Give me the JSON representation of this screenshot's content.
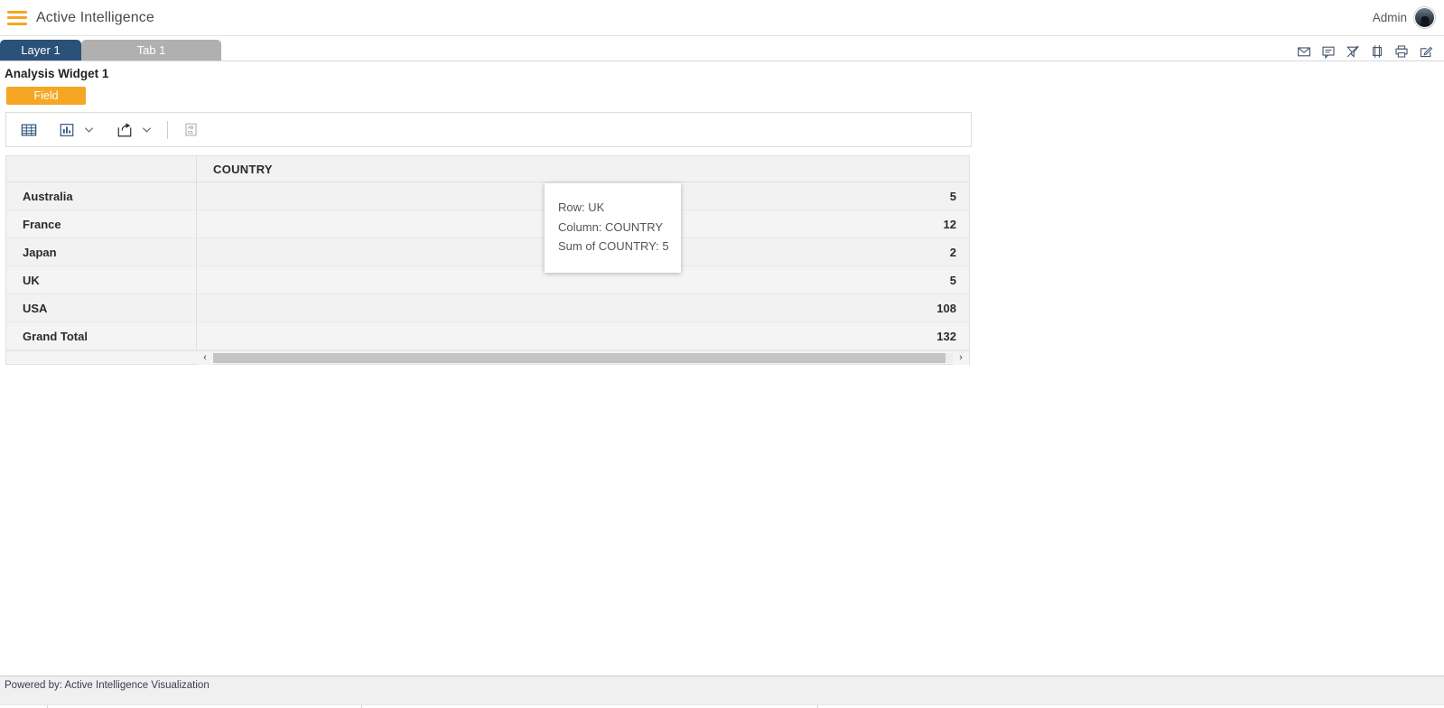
{
  "appbar": {
    "menu_icon": "hamburger-menu-icon",
    "title": "Active Intelligence",
    "user_name": "Admin",
    "avatar_icon": "user-avatar"
  },
  "tabstrip": {
    "tabs": [
      {
        "label": "Layer 1",
        "active": true
      },
      {
        "label": "Tab 1",
        "active": false
      }
    ],
    "actions": [
      {
        "name": "mail-icon",
        "title": "Mail"
      },
      {
        "name": "comment-icon",
        "title": "Comment"
      },
      {
        "name": "clear-filter-icon",
        "title": "Clear Filter"
      },
      {
        "name": "crop-icon",
        "title": "Crop"
      },
      {
        "name": "print-icon",
        "title": "Print"
      },
      {
        "name": "edit-icon",
        "title": "Edit"
      }
    ]
  },
  "widget": {
    "title": "Analysis Widget 1",
    "field_chip": "Field",
    "toolbar": [
      {
        "name": "table-view-icon",
        "title": "Table"
      },
      {
        "name": "chart-view-icon",
        "title": "Chart"
      },
      {
        "name": "chart-dropdown-caret",
        "title": "Chart options"
      },
      {
        "name": "export-share-icon",
        "title": "Export"
      },
      {
        "name": "export-dropdown-caret",
        "title": "Export options"
      },
      {
        "name": "sort-abc-icon",
        "title": "Sort"
      }
    ]
  },
  "pivot": {
    "row_header_label": "",
    "column_header": "COUNTRY",
    "rows": [
      {
        "label": "Australia",
        "value": "5"
      },
      {
        "label": "France",
        "value": "12"
      },
      {
        "label": "Japan",
        "value": "2"
      },
      {
        "label": "UK",
        "value": "5"
      },
      {
        "label": "USA",
        "value": "108"
      },
      {
        "label": "Grand Total",
        "value": "132"
      }
    ],
    "scroll_left_arrow": "‹",
    "scroll_right_arrow": "›"
  },
  "tooltip": {
    "row": "Row:  UK",
    "column": "Column: COUNTRY",
    "sum": "Sum of COUNTRY: 5"
  },
  "footer": {
    "text": "Powered by: Active Intelligence Visualization"
  },
  "chart_data": {
    "type": "table",
    "title": "Analysis Widget 1",
    "categories": [
      "Australia",
      "France",
      "Japan",
      "UK",
      "USA",
      "Grand Total"
    ],
    "values": [
      5,
      12,
      2,
      5,
      108,
      132
    ],
    "xlabel": "",
    "ylabel": "COUNTRY"
  },
  "colors": {
    "brand_orange": "#f5a623",
    "active_tab_blue": "#2b5179",
    "inactive_tab_gray": "#b0b0b0",
    "canvas_gray": "#dedede"
  }
}
